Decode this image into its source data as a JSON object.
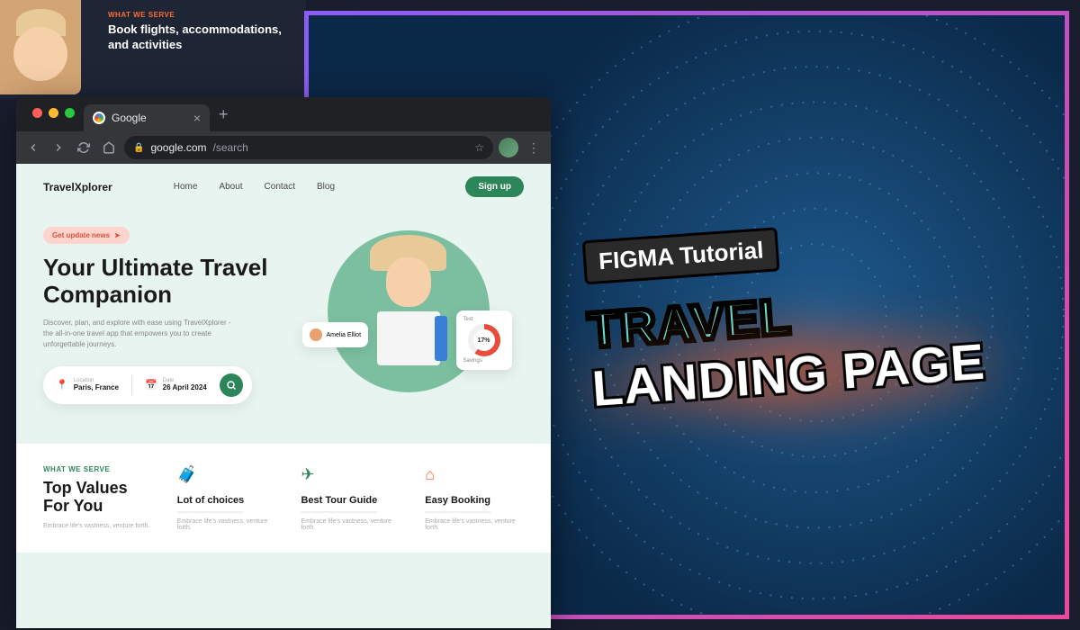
{
  "bg_preview": {
    "eyebrow": "WHAT WE SERVE",
    "heading": "Book flights, accommodations, and activities"
  },
  "browser": {
    "tab_title": "Google",
    "url_host": "google.com",
    "url_path": "/search"
  },
  "site": {
    "brand": "TravelXplorer",
    "nav": [
      "Home",
      "About",
      "Contact",
      "Blog"
    ],
    "signup": "Sign up"
  },
  "hero": {
    "badge": "Get update news",
    "title": "Your Ultimate Travel Companion",
    "subtitle": "Discover, plan, and explore with ease using TravelXplorer - the all-in-one travel app that empowers you to create unforgettable journeys.",
    "location_label": "Location",
    "location_value": "Paris, France",
    "date_label": "Date",
    "date_value": "26 April 2024",
    "user_card_name": "Amelia Elliot",
    "chart_label": "Text",
    "chart_percent": "17%",
    "chart_sub": "Savings"
  },
  "values": {
    "eyebrow": "WHAT WE SERVE",
    "title": "Top Values For You",
    "desc": "Embrace life's vastness, venture forth.",
    "cols": [
      {
        "title": "Lot of choices",
        "desc": "Embrace life's vastness, venture forth."
      },
      {
        "title": "Best Tour Guide",
        "desc": "Embrace life's vastness, venture forth."
      },
      {
        "title": "Easy Booking",
        "desc": "Embrace life's vastness, venture forth."
      }
    ]
  },
  "thumbnail": {
    "badge": "FIGMA Tutorial",
    "line1": "TRAVEL",
    "line2": "LANDING PAGE"
  }
}
